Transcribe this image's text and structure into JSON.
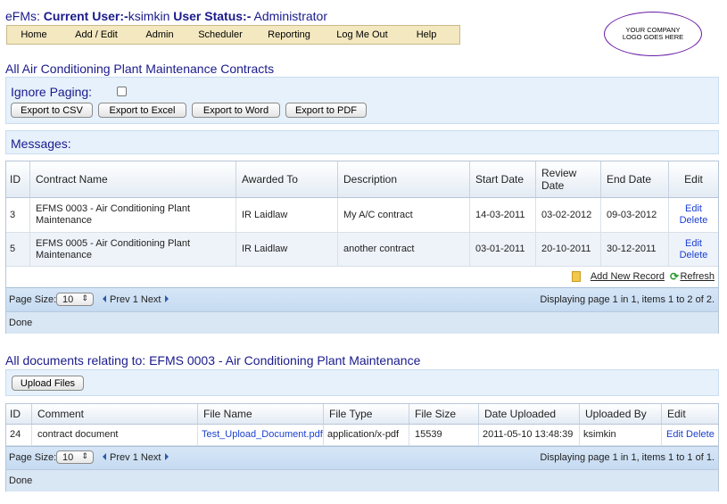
{
  "header": {
    "prefix": "eFMs:",
    "current_user_label": "Current User:-",
    "current_user": "ksimkin",
    "status_label": "User Status:-",
    "status": "Administrator"
  },
  "menu": [
    "Home",
    "Add / Edit",
    "Admin",
    "Scheduler",
    "Reporting",
    "Log Me Out",
    "Help"
  ],
  "logo_text": "YOUR COMPANY LOGO GOES HERE",
  "contracts": {
    "title": "All Air Conditioning Plant Maintenance Contracts",
    "ignore_paging_label": "Ignore Paging:",
    "export_buttons": [
      "Export to CSV",
      "Export to Excel",
      "Export to Word",
      "Export to PDF"
    ],
    "messages_label": "Messages:",
    "columns": [
      "ID",
      "Contract Name",
      "Awarded To",
      "Description",
      "Start Date",
      "Review Date",
      "End Date",
      "Edit"
    ],
    "rows": [
      {
        "id": "3",
        "name": "EFMS 0003 - Air Conditioning Plant Maintenance",
        "awarded": "IR Laidlaw",
        "desc": "My A/C contract",
        "start": "14-03-2011",
        "review": "03-02-2012",
        "end": "09-03-2012",
        "edit": "Edit",
        "delete": "Delete"
      },
      {
        "id": "5",
        "name": "EFMS 0005 - Air Conditioning Plant Maintenance",
        "awarded": "IR Laidlaw",
        "desc": "another contract",
        "start": "03-01-2011",
        "review": "20-10-2011",
        "end": "30-12-2011",
        "edit": "Edit",
        "delete": "Delete"
      }
    ],
    "add_new": "Add New Record",
    "refresh": "Refresh",
    "page_size_label": "Page Size:",
    "page_size": "10",
    "prev": "Prev",
    "page": "1",
    "next": "Next",
    "paging_info": "Displaying page 1 in 1, items 1 to 2 of 2.",
    "status": "Done"
  },
  "documents": {
    "title": "All documents relating to: EFMS 0003 - Air Conditioning Plant Maintenance",
    "upload_button": "Upload Files",
    "columns": [
      "ID",
      "Comment",
      "File Name",
      "File Type",
      "File Size",
      "Date Uploaded",
      "Uploaded By",
      "Edit"
    ],
    "rows": [
      {
        "id": "24",
        "comment": "contract document",
        "file": "Test_Upload_Document.pdf",
        "type": "application/x-pdf",
        "size": "15539",
        "date": "2011-05-10 13:48:39",
        "by": "ksimkin",
        "edit": "Edit",
        "delete": "Delete"
      }
    ],
    "page_size_label": "Page Size:",
    "page_size": "10",
    "prev": "Prev",
    "page": "1",
    "next": "Next",
    "paging_info": "Displaying page 1 in 1, items 1 to 1 of 1.",
    "status": "Done"
  },
  "colors": {
    "title": "#1a1a8c",
    "menu_bg": "#f3e8bf",
    "panel_bg": "#e6f1fb",
    "link": "#1a3fd0"
  }
}
